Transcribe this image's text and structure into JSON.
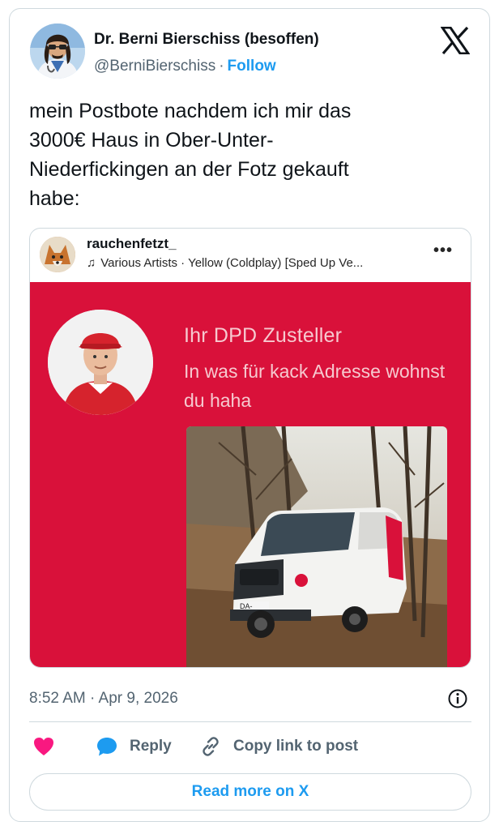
{
  "author": {
    "name": "Dr. Berni Bierschiss (besoffen)",
    "handle": "@BerniBierschiss",
    "separator": "·",
    "follow_label": "Follow"
  },
  "tweet": {
    "text": "mein Postbote nachdem ich mir das\n3000€ Haus in Ober-Unter-\nNiederfickingen an der Fotz gekauft\nhabe:"
  },
  "embed": {
    "username": "rauchenfetzt_",
    "music": "Various Artists · Yellow (Coldplay) [Sped Up Ve...",
    "more_icon": "more-horizontal-icon",
    "media": {
      "title": "Ihr DPD Zusteller",
      "subtitle": "In was für kack Adresse wohnst du haha",
      "background_color": "#d9113a",
      "plate_text": "DA-"
    }
  },
  "timestamp": "8:52 AM · Apr 9, 2026",
  "actions": {
    "like_icon": "heart-icon",
    "reply_icon": "speech-bubble-icon",
    "reply_label": "Reply",
    "copy_icon": "link-icon",
    "copy_label": "Copy link to post"
  },
  "read_more_label": "Read more on X",
  "colors": {
    "accent": "#1d9bf0",
    "like": "#f91880",
    "text": "#0f1419",
    "secondary": "#536471",
    "border": "#cfd9de"
  }
}
